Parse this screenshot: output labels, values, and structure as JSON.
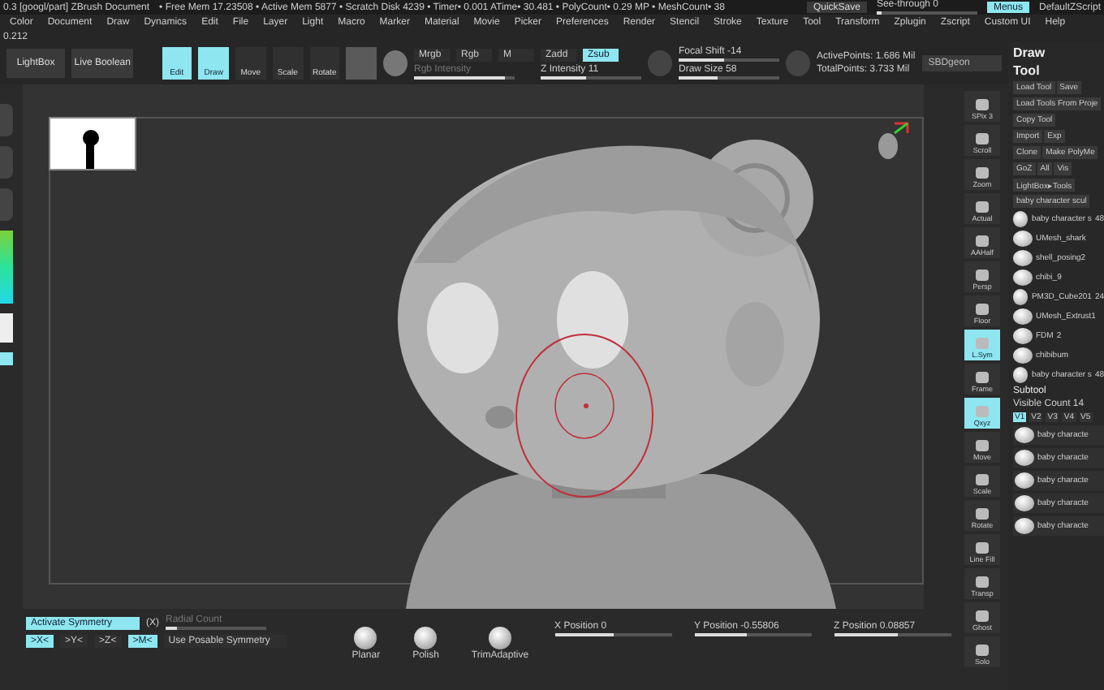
{
  "title_bar": {
    "document": "0.3 [googl/part]  ZBrush Document",
    "stats": "• Free Mem 17.23508 • Active Mem 5877 • Scratch Disk 4239 • Timer• 0.001 ATime• 30.481 • PolyCount• 0.29 MP • MeshCount• 38",
    "quicksave": "QuickSave",
    "see_through": {
      "label": "See-through 0",
      "level": 0.05
    },
    "menus": {
      "label": "Menus",
      "selected": true
    },
    "script": "DefaultZScript"
  },
  "menu_bar": [
    "Color",
    "Document",
    "Draw",
    "Dynamics",
    "Edit",
    "File",
    "Layer",
    "Light",
    "Macro",
    "Marker",
    "Material",
    "Movie",
    "Picker",
    "Preferences",
    "Render",
    "Stencil",
    "Stroke",
    "Texture",
    "Tool",
    "Transform",
    "Zplugin",
    "Zscript",
    "Custom UI",
    "Help"
  ],
  "version": "0.212",
  "toolbar": {
    "left_buttons": [
      {
        "label": "LightBox",
        "selected": false
      },
      {
        "label": "Live Boolean",
        "selected": false
      }
    ],
    "mode_buttons": [
      {
        "label": "Edit",
        "selected": true
      },
      {
        "label": "Draw",
        "selected": true
      },
      {
        "label": "Move",
        "selected": false
      },
      {
        "label": "Scale",
        "selected": false
      },
      {
        "label": "Rotate",
        "selected": false
      }
    ],
    "channels": [
      {
        "label": "Mrgb",
        "selected": false
      },
      {
        "label": "Rgb",
        "selected": false
      },
      {
        "label": "M",
        "selected": false
      }
    ],
    "rgb_intensity": {
      "label": "Rgb Intensity",
      "level": 0.9
    },
    "depth": [
      {
        "label": "Zadd",
        "selected": false
      },
      {
        "label": "Zsub",
        "selected": true
      }
    ],
    "z_intensity": {
      "label": "Z Intensity 11",
      "level": 0.45
    },
    "focal_shift": {
      "label": "Focal Shift -14",
      "level": 0.45
    },
    "draw_size": {
      "label": "Draw Size 58",
      "level": 0.38
    },
    "active_points": "ActivePoints: 1.686 Mil",
    "total_points": "TotalPoints: 3.733 Mil",
    "field": "SBDgeon"
  },
  "view_buttons": [
    {
      "label": "SPix 3",
      "selected": false
    },
    {
      "label": "Scroll",
      "selected": false
    },
    {
      "label": "Zoom",
      "selected": false
    },
    {
      "label": "Actual",
      "selected": false
    },
    {
      "label": "AAHalf",
      "selected": false
    },
    {
      "label": "Persp",
      "selected": false
    },
    {
      "label": "Floor",
      "selected": false
    },
    {
      "label": "L.Sym",
      "selected": true
    },
    {
      "label": "Frame",
      "selected": false
    },
    {
      "label": "Qxyz",
      "selected": true
    },
    {
      "label": "Move",
      "selected": false
    },
    {
      "label": "Scale",
      "selected": false
    },
    {
      "label": "Rotate",
      "selected": false
    },
    {
      "label": "Line Fill",
      "selected": false
    },
    {
      "label": "Transp",
      "selected": false
    },
    {
      "label": "Ghost",
      "selected": false
    },
    {
      "label": "Solo",
      "selected": false
    }
  ],
  "right_panel": {
    "headers": [
      "Draw",
      "Tool"
    ],
    "rows": [
      [
        "Load Tool",
        "Save"
      ],
      [
        "Load Tools From Proje"
      ],
      [
        "Copy Tool"
      ],
      [
        "Import",
        "Exp"
      ],
      [
        "Clone",
        "Make PolyMe"
      ],
      [
        "GoZ",
        "All",
        "Vis"
      ],
      [
        "LightBox▸Tools"
      ],
      [
        "baby character scul"
      ]
    ],
    "tools": [
      {
        "name": "baby character s",
        "count": "48"
      },
      {
        "name": "UMesh_shark"
      },
      {
        "name": "shell_posing2"
      },
      {
        "name": "chibi_9"
      },
      {
        "name": "PM3D_Cube201",
        "count": "24"
      },
      {
        "name": "UMesh_Extrust1"
      },
      {
        "name": "FDM",
        "count": "2"
      },
      {
        "name": "chibibum"
      },
      {
        "name": "baby character s",
        "count": "48"
      }
    ],
    "subtool": {
      "title": "Subtool",
      "visible_count": "Visible Count 14",
      "versions": [
        {
          "label": "V1",
          "selected": true
        },
        {
          "label": "V2",
          "selected": false
        },
        {
          "label": "V3",
          "selected": false
        },
        {
          "label": "V4",
          "selected": false
        },
        {
          "label": "V5",
          "selected": false
        }
      ],
      "items": [
        "baby characte",
        "baby characte",
        "baby characte",
        "baby characte",
        "baby characte"
      ]
    }
  },
  "symmetry": {
    "activate": {
      "label": "Activate Symmetry",
      "selected": true
    },
    "key": "(X)",
    "radial": {
      "label": "Radial Count",
      "level": 0.12
    },
    "axes": [
      {
        "label": ">X<",
        "selected": true
      },
      {
        "label": ">Y<",
        "selected": false
      },
      {
        "label": ">Z<",
        "selected": false
      },
      {
        "label": ">M<",
        "selected": true
      }
    ],
    "posable": "Use Posable Symmetry"
  },
  "brushes": [
    "Planar",
    "Polish",
    "TrimAdaptive"
  ],
  "positions": [
    {
      "label": "X Position 0",
      "level": 0.5
    },
    {
      "label": "Y Position -0.55806",
      "level": 0.45
    },
    {
      "label": "Z Position 0.08857",
      "level": 0.55
    }
  ]
}
